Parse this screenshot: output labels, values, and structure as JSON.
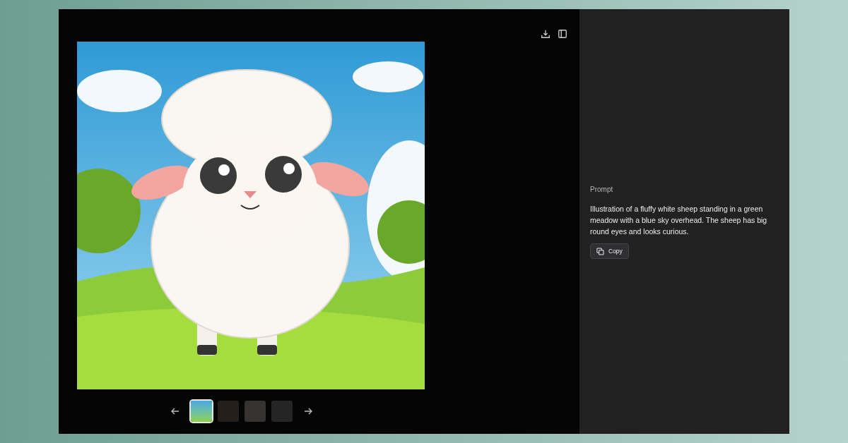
{
  "viewer": {
    "thumbnails": [
      {
        "selected": true
      },
      {
        "selected": false
      },
      {
        "selected": false
      },
      {
        "selected": false
      }
    ]
  },
  "details": {
    "label": "Prompt",
    "prompt": "Illustration of a fluffy white sheep standing in a green meadow with a blue sky overhead. The sheep has big round eyes and looks curious.",
    "copy_button": "Copy"
  }
}
